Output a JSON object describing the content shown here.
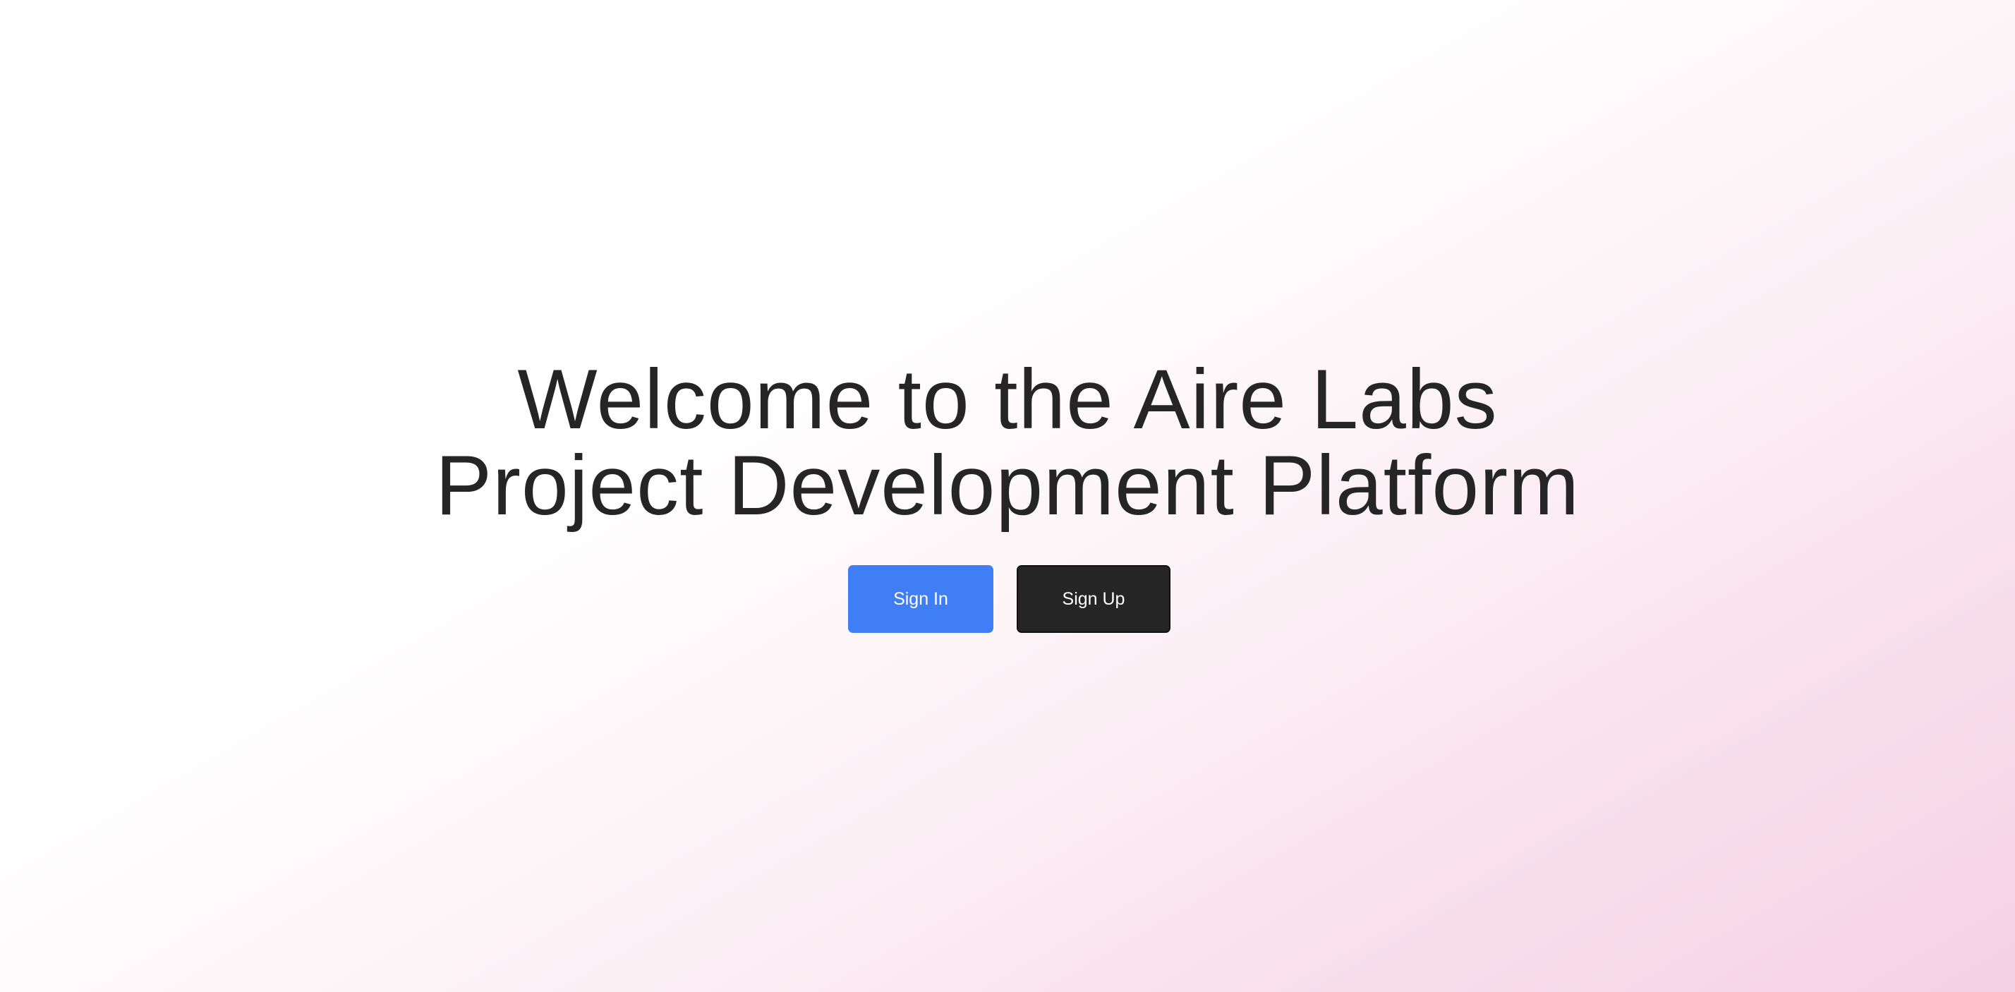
{
  "hero": {
    "title_line1": "Welcome to the Aire Labs",
    "title_line2": "Project Development Platform"
  },
  "actions": {
    "sign_in_label": "Sign In",
    "sign_up_label": "Sign Up"
  },
  "colors": {
    "primary_button": "#3f7ef5",
    "secondary_button": "#252525",
    "text": "#252525",
    "gradient_accent": "#f5d2e4"
  }
}
